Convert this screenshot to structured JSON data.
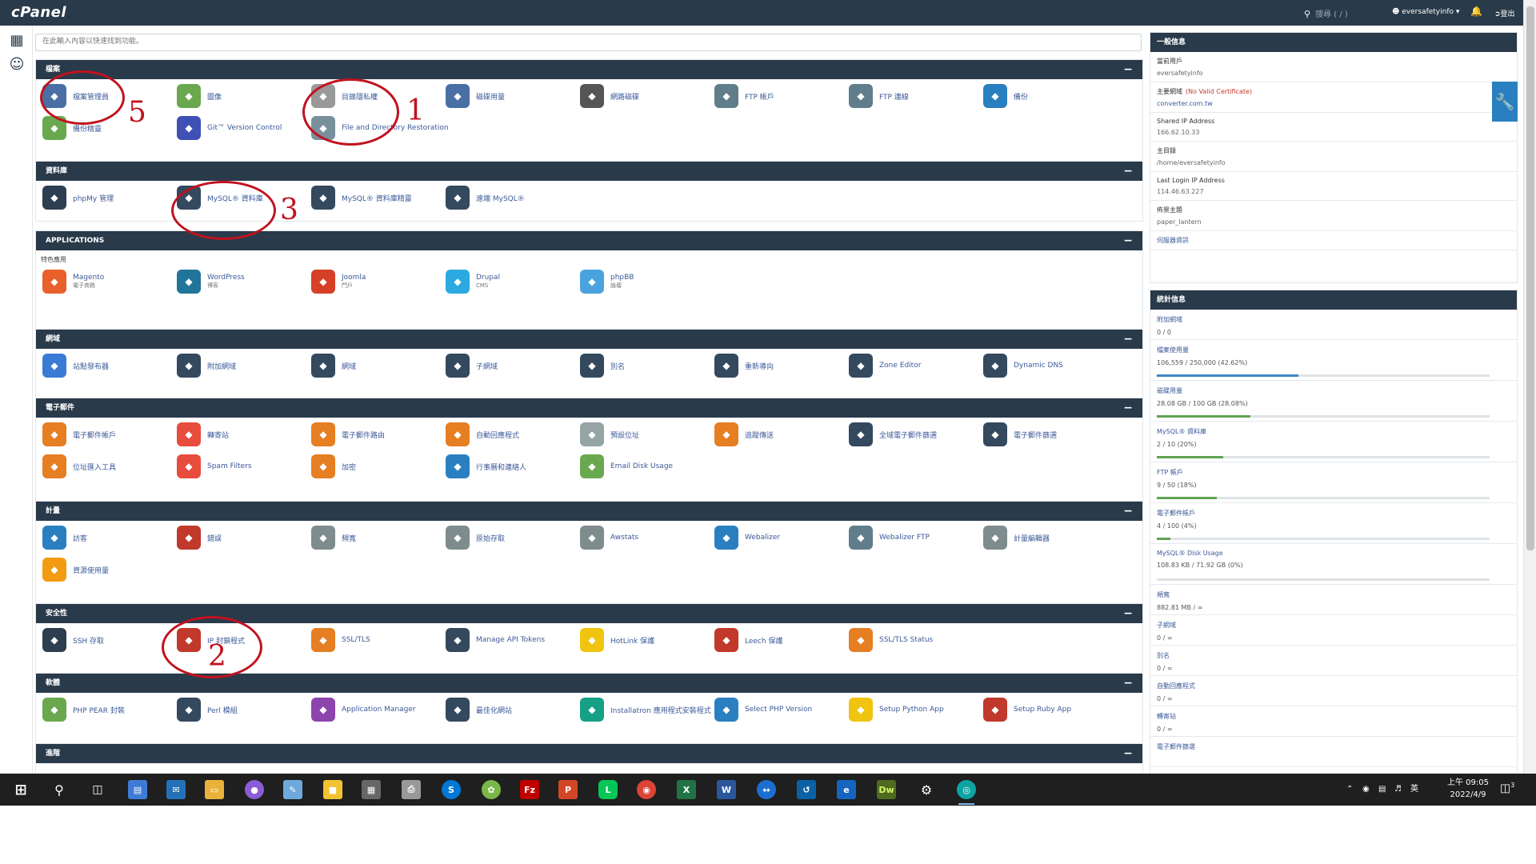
{
  "topbar": {
    "logo": "cPanel",
    "search_hint": "搜尋 ( / )",
    "username": "eversafetyinfo",
    "logout": "登出"
  },
  "search": {
    "placeholder": "在此輸入內容以快速找到功能。"
  },
  "sections": [
    {
      "title": "檔案",
      "items": [
        {
          "label": "檔案管理員",
          "icon": "file-manager-icon",
          "color": "#4a6fa5"
        },
        {
          "label": "圖像",
          "icon": "images-icon",
          "color": "#6aa84f"
        },
        {
          "label": "目錄隱私權",
          "icon": "directory-privacy-icon",
          "color": "#999999"
        },
        {
          "label": "磁碟用量",
          "icon": "disk-usage-icon",
          "color": "#4a6fa5"
        },
        {
          "label": "網路磁碟",
          "icon": "web-disk-icon",
          "color": "#555555"
        },
        {
          "label": "FTP 帳戶",
          "icon": "ftp-accounts-icon",
          "color": "#607d8b"
        },
        {
          "label": "FTP 連線",
          "icon": "ftp-connections-icon",
          "color": "#607d8b"
        },
        {
          "label": "備份",
          "icon": "backup-icon",
          "color": "#2a7fc0"
        },
        {
          "label": "備份精靈",
          "icon": "backup-wizard-icon",
          "color": "#6aa84f"
        },
        {
          "label": "Git™ Version Control",
          "icon": "git-icon",
          "color": "#3f51b5"
        },
        {
          "label": "File and Directory Restoration",
          "icon": "restoration-icon",
          "color": "#78909c"
        }
      ]
    },
    {
      "title": "資料庫",
      "items": [
        {
          "label": "phpMy 管理",
          "icon": "phpmyadmin-icon",
          "color": "#2c3e50"
        },
        {
          "label": "MySQL® 資料庫",
          "icon": "mysql-databases-icon",
          "color": "#34495e"
        },
        {
          "label": "MySQL® 資料庫精靈",
          "icon": "mysql-wizard-icon",
          "color": "#34495e"
        },
        {
          "label": "遠端 MySQL®",
          "icon": "remote-mysql-icon",
          "color": "#34495e"
        }
      ]
    },
    {
      "title": "APPLICATIONS",
      "sublabel": "特色應用",
      "items": [
        {
          "label": "Magento",
          "sub": "電子商務",
          "icon": "magento-icon",
          "color": "#e8602c"
        },
        {
          "label": "WordPress",
          "sub": "博客",
          "icon": "wordpress-icon",
          "color": "#21759b"
        },
        {
          "label": "Joomla",
          "sub": "門戶",
          "icon": "joomla-icon",
          "color": "#d64027"
        },
        {
          "label": "Drupal",
          "sub": "CMS",
          "icon": "drupal-icon",
          "color": "#2ba9e0"
        },
        {
          "label": "phpBB",
          "sub": "論壇",
          "icon": "phpbb-icon",
          "color": "#4aa3df"
        }
      ]
    },
    {
      "title": "網域",
      "items": [
        {
          "label": "站點發布器",
          "icon": "site-publisher-icon",
          "color": "#3a7bd5"
        },
        {
          "label": "附加網域",
          "icon": "addon-domains-icon",
          "color": "#34495e"
        },
        {
          "label": "網域",
          "icon": "domains-icon",
          "color": "#34495e"
        },
        {
          "label": "子網域",
          "icon": "subdomains-icon",
          "color": "#34495e"
        },
        {
          "label": "別名",
          "icon": "aliases-icon",
          "color": "#34495e"
        },
        {
          "label": "重新導向",
          "icon": "redirects-icon",
          "color": "#34495e"
        },
        {
          "label": "Zone Editor",
          "icon": "zone-editor-icon",
          "color": "#34495e"
        },
        {
          "label": "Dynamic DNS",
          "icon": "dynamic-dns-icon",
          "color": "#34495e"
        }
      ]
    },
    {
      "title": "電子郵件",
      "items": [
        {
          "label": "電子郵件帳戶",
          "icon": "email-accounts-icon",
          "color": "#e67e22"
        },
        {
          "label": "轉寄站",
          "icon": "forwarders-icon",
          "color": "#e74c3c"
        },
        {
          "label": "電子郵件路由",
          "icon": "email-routing-icon",
          "color": "#e67e22"
        },
        {
          "label": "自動回應程式",
          "icon": "autoresponders-icon",
          "color": "#e67e22"
        },
        {
          "label": "預設位址",
          "icon": "default-address-icon",
          "color": "#95a5a6"
        },
        {
          "label": "追蹤傳送",
          "icon": "track-delivery-icon",
          "color": "#e67e22"
        },
        {
          "label": "全域電子郵件篩選",
          "icon": "global-filters-icon",
          "color": "#34495e"
        },
        {
          "label": "電子郵件篩選",
          "icon": "email-filters-icon",
          "color": "#34495e"
        },
        {
          "label": "位址匯入工具",
          "icon": "address-importer-icon",
          "color": "#e67e22"
        },
        {
          "label": "Spam Filters",
          "icon": "spam-filters-icon",
          "color": "#e74c3c"
        },
        {
          "label": "加密",
          "icon": "encryption-icon",
          "color": "#e67e22"
        },
        {
          "label": "行事曆和連絡人",
          "icon": "calendars-icon",
          "color": "#2a7fc0"
        },
        {
          "label": "Email Disk Usage",
          "icon": "email-disk-usage-icon",
          "color": "#6aa84f"
        }
      ]
    },
    {
      "title": "計量",
      "items": [
        {
          "label": "訪客",
          "icon": "visitors-icon",
          "color": "#2a7fc0"
        },
        {
          "label": "錯誤",
          "icon": "errors-icon",
          "color": "#c0392b"
        },
        {
          "label": "頻寬",
          "icon": "bandwidth-icon",
          "color": "#7f8c8d"
        },
        {
          "label": "原始存取",
          "icon": "raw-access-icon",
          "color": "#7f8c8d"
        },
        {
          "label": "Awstats",
          "icon": "awstats-icon",
          "color": "#7f8c8d"
        },
        {
          "label": "Webalizer",
          "icon": "webalizer-icon",
          "color": "#2a7fc0"
        },
        {
          "label": "Webalizer FTP",
          "icon": "webalizer-ftp-icon",
          "color": "#607d8b"
        },
        {
          "label": "計量編輯器",
          "icon": "metrics-editor-icon",
          "color": "#7f8c8d"
        },
        {
          "label": "資源使用量",
          "icon": "resource-usage-icon",
          "color": "#f39c12"
        }
      ]
    },
    {
      "title": "安全性",
      "items": [
        {
          "label": "SSH 存取",
          "icon": "ssh-access-icon",
          "color": "#2c3e50"
        },
        {
          "label": "IP 封鎖程式",
          "icon": "ip-blocker-icon",
          "color": "#c0392b"
        },
        {
          "label": "SSL/TLS",
          "icon": "ssl-tls-icon",
          "color": "#e67e22"
        },
        {
          "label": "Manage API Tokens",
          "icon": "api-tokens-icon",
          "color": "#34495e"
        },
        {
          "label": "HotLink 保護",
          "icon": "hotlink-icon",
          "color": "#f1c40f"
        },
        {
          "label": "Leech 保護",
          "icon": "leech-icon",
          "color": "#c0392b"
        },
        {
          "label": "SSL/TLS Status",
          "icon": "ssl-status-icon",
          "color": "#e67e22"
        }
      ]
    },
    {
      "title": "軟體",
      "items": [
        {
          "label": "PHP PEAR 封裝",
          "icon": "php-pear-icon",
          "color": "#6aa84f"
        },
        {
          "label": "Perl 模組",
          "icon": "perl-icon",
          "color": "#34495e"
        },
        {
          "label": "Application Manager",
          "icon": "app-manager-icon",
          "color": "#8e44ad"
        },
        {
          "label": "最佳化網站",
          "icon": "optimize-icon",
          "color": "#34495e"
        },
        {
          "label": "Installatron 應用程式安裝程式",
          "icon": "installatron-icon",
          "color": "#16a085"
        },
        {
          "label": "Select PHP Version",
          "icon": "php-version-icon",
          "color": "#2a7fc0"
        },
        {
          "label": "Setup Python App",
          "icon": "python-icon",
          "color": "#f1c40f"
        },
        {
          "label": "Setup Ruby App",
          "icon": "ruby-icon",
          "color": "#c0392b"
        }
      ]
    },
    {
      "title": "進階",
      "items": []
    }
  ],
  "general_info": {
    "title": "一般信息",
    "rows": [
      {
        "k": "當前用戶",
        "v": "eversafetyinfo"
      },
      {
        "k": "主要網域",
        "k_warn": "(No Valid Certificate)",
        "v": "converter.com.tw",
        "link": true
      },
      {
        "k": "Shared IP Address",
        "v": "166.62.10.33"
      },
      {
        "k": "主目錄",
        "v": "/home/eversafetyinfo"
      },
      {
        "k": "Last Login IP Address",
        "v": "114.46.63.227"
      },
      {
        "k": "佈景主題",
        "v": "paper_lantern"
      },
      {
        "k": "伺服器資訊",
        "v": "",
        "link": true
      }
    ]
  },
  "stats": {
    "title": "統計信息",
    "rows": [
      {
        "k": "附加網域",
        "v": "0 / 0",
        "pct": 0
      },
      {
        "k": "檔案使用量",
        "v": "106,559 / 250,000   (42.62%)",
        "pct": 42.62,
        "bar": "blue"
      },
      {
        "k": "磁碟用量",
        "v": "28.08 GB / 100 GB   (28.08%)",
        "pct": 28.08
      },
      {
        "k": "MySQL® 資料庫",
        "v": "2 / 10   (20%)",
        "pct": 20
      },
      {
        "k": "FTP 帳戶",
        "v": "9 / 50   (18%)",
        "pct": 18
      },
      {
        "k": "電子郵件帳戶",
        "v": "4 / 100   (4%)",
        "pct": 4
      },
      {
        "k": "MySQL® Disk Usage",
        "v": "108.83 KB / 71.92 GB   (0%)",
        "pct": 0
      },
      {
        "k": "頻寬",
        "v": "882.81 MB / ∞"
      },
      {
        "k": "子網域",
        "v": "0 / ∞"
      },
      {
        "k": "別名",
        "v": "0 / ∞"
      },
      {
        "k": "自動回應程式",
        "v": "0 / ∞"
      },
      {
        "k": "轉寄站",
        "v": "0 / ∞"
      },
      {
        "k": "電子郵件篩選",
        "v": ""
      }
    ]
  },
  "annotations": [
    "5",
    "1",
    "3",
    "2"
  ],
  "taskbar": {
    "clock_time": "上午 09:05",
    "clock_date": "2022/4/9",
    "ime": "英",
    "notif_count": "3"
  }
}
